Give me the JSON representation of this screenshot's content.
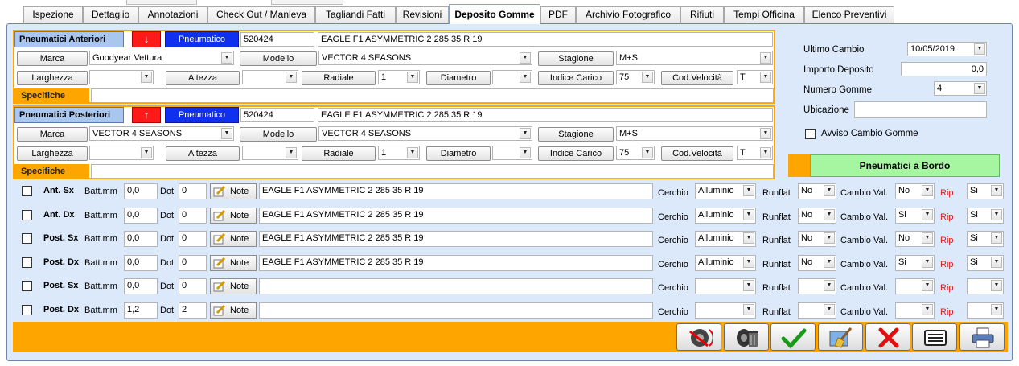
{
  "tabs": [
    {
      "label": "Ispezione"
    },
    {
      "label": "Dettaglio"
    },
    {
      "label": "Annotazioni"
    },
    {
      "label": "Check Out / Manleva"
    },
    {
      "label": "Tagliandi Fatti"
    },
    {
      "label": "Revisioni"
    },
    {
      "label": "Deposito Gomme"
    },
    {
      "label": "PDF"
    },
    {
      "label": "Archivio Fotografico"
    },
    {
      "label": "Rifiuti"
    },
    {
      "label": "Tempi Officina"
    },
    {
      "label": "Elenco Preventivi"
    }
  ],
  "front": {
    "title": "Pneumatici Anteriori",
    "arrow": "↓",
    "pneumatico_label": "Pneumatico",
    "code": "520424",
    "description": "EAGLE F1 ASYMMETRIC 2 285 35 R 19",
    "marca_label": "Marca",
    "marca_value": "Goodyear Vettura",
    "modello_label": "Modello",
    "modello_value": "VECTOR 4 SEASONS",
    "stagione_label": "Stagione",
    "stagione_value": "M+S",
    "larghezza_label": "Larghezza",
    "larghezza_value": "",
    "altezza_label": "Altezza",
    "altezza_value": "",
    "radiale_label": "Radiale",
    "radiale_value": "1",
    "diametro_label": "Diametro",
    "diametro_value": "",
    "indice_label": "Indice Carico",
    "indice_value": "75",
    "codvel_label": "Cod.Velocità",
    "codvel_value": "T",
    "specifiche_label": "Specifiche",
    "specifiche_value": ""
  },
  "rear": {
    "title": "Pneumatici Posteriori",
    "arrow": "↑",
    "pneumatico_label": "Pneumatico",
    "code": "520424",
    "description": "EAGLE F1 ASYMMETRIC 2 285 35 R 19",
    "marca_label": "Marca",
    "marca_value": "VECTOR 4 SEASONS",
    "modello_label": "Modello",
    "modello_value": "VECTOR 4 SEASONS",
    "stagione_label": "Stagione",
    "stagione_value": "M+S",
    "larghezza_label": "Larghezza",
    "larghezza_value": "",
    "altezza_label": "Altezza",
    "altezza_value": "",
    "radiale_label": "Radiale",
    "radiale_value": "1",
    "diametro_label": "Diametro",
    "diametro_value": "",
    "indice_label": "Indice Carico",
    "indice_value": "75",
    "codvel_label": "Cod.Velocità",
    "codvel_value": "T",
    "specifiche_label": "Specifiche",
    "specifiche_value": ""
  },
  "info": {
    "ultimo_cambio_label": "Ultimo Cambio",
    "ultimo_cambio_value": "10/05/2019",
    "importo_label": "Importo Deposito",
    "importo_value": "0,0",
    "numero_label": "Numero Gomme",
    "numero_value": "4",
    "ubicazione_label": "Ubicazione",
    "ubicazione_value": "",
    "avviso_label": "Avviso Cambio Gomme",
    "bordo_label": "Pneumatici a Bordo"
  },
  "row_labels": {
    "batt": "Batt.mm",
    "dot": "Dot",
    "note": "Note",
    "cerchio": "Cerchio",
    "runflat": "Runflat",
    "cambio": "Cambio Val.",
    "rip": "Rip"
  },
  "rows": [
    {
      "pos": "Ant. Sx",
      "batt": "0,0",
      "dot": "0",
      "desc": "EAGLE F1 ASYMMETRIC 2 285 35 R 19",
      "cerchio": "Alluminio",
      "runflat": "No",
      "cambio": "No",
      "rip": "Si"
    },
    {
      "pos": "Ant. Dx",
      "batt": "0,0",
      "dot": "0",
      "desc": "EAGLE F1 ASYMMETRIC 2 285 35 R 19",
      "cerchio": "Alluminio",
      "runflat": "No",
      "cambio": "Si",
      "rip": "Si"
    },
    {
      "pos": "Post. Sx",
      "batt": "0,0",
      "dot": "0",
      "desc": "EAGLE F1 ASYMMETRIC 2 285 35 R 19",
      "cerchio": "Alluminio",
      "runflat": "No",
      "cambio": "No",
      "rip": "Si"
    },
    {
      "pos": "Post. Dx",
      "batt": "0,0",
      "dot": "0",
      "desc": "EAGLE F1 ASYMMETRIC 2 285 35 R 19",
      "cerchio": "Alluminio",
      "runflat": "No",
      "cambio": "Si",
      "rip": "Si"
    },
    {
      "pos": "Post. Sx",
      "batt": "0,0",
      "dot": "0",
      "desc": "",
      "cerchio": "",
      "runflat": "",
      "cambio": "",
      "rip": ""
    },
    {
      "pos": "Post. Dx",
      "batt": "1,2",
      "dot": "2",
      "desc": "",
      "cerchio": "",
      "runflat": "",
      "cambio": "",
      "rip": ""
    }
  ],
  "toolbar_icons": [
    "tire-rotate-icon",
    "tire-trash-icon",
    "confirm-check-icon",
    "broom-clean-icon",
    "cancel-x-icon",
    "list-icon",
    "printer-icon"
  ],
  "colors": {
    "accent_orange": "#ffa500",
    "panel_blue": "#dce9fa",
    "bordo_green": "#a6f5a0",
    "pneumatico_blue": "#1030f0",
    "arrow_red": "#ff1a1a"
  }
}
